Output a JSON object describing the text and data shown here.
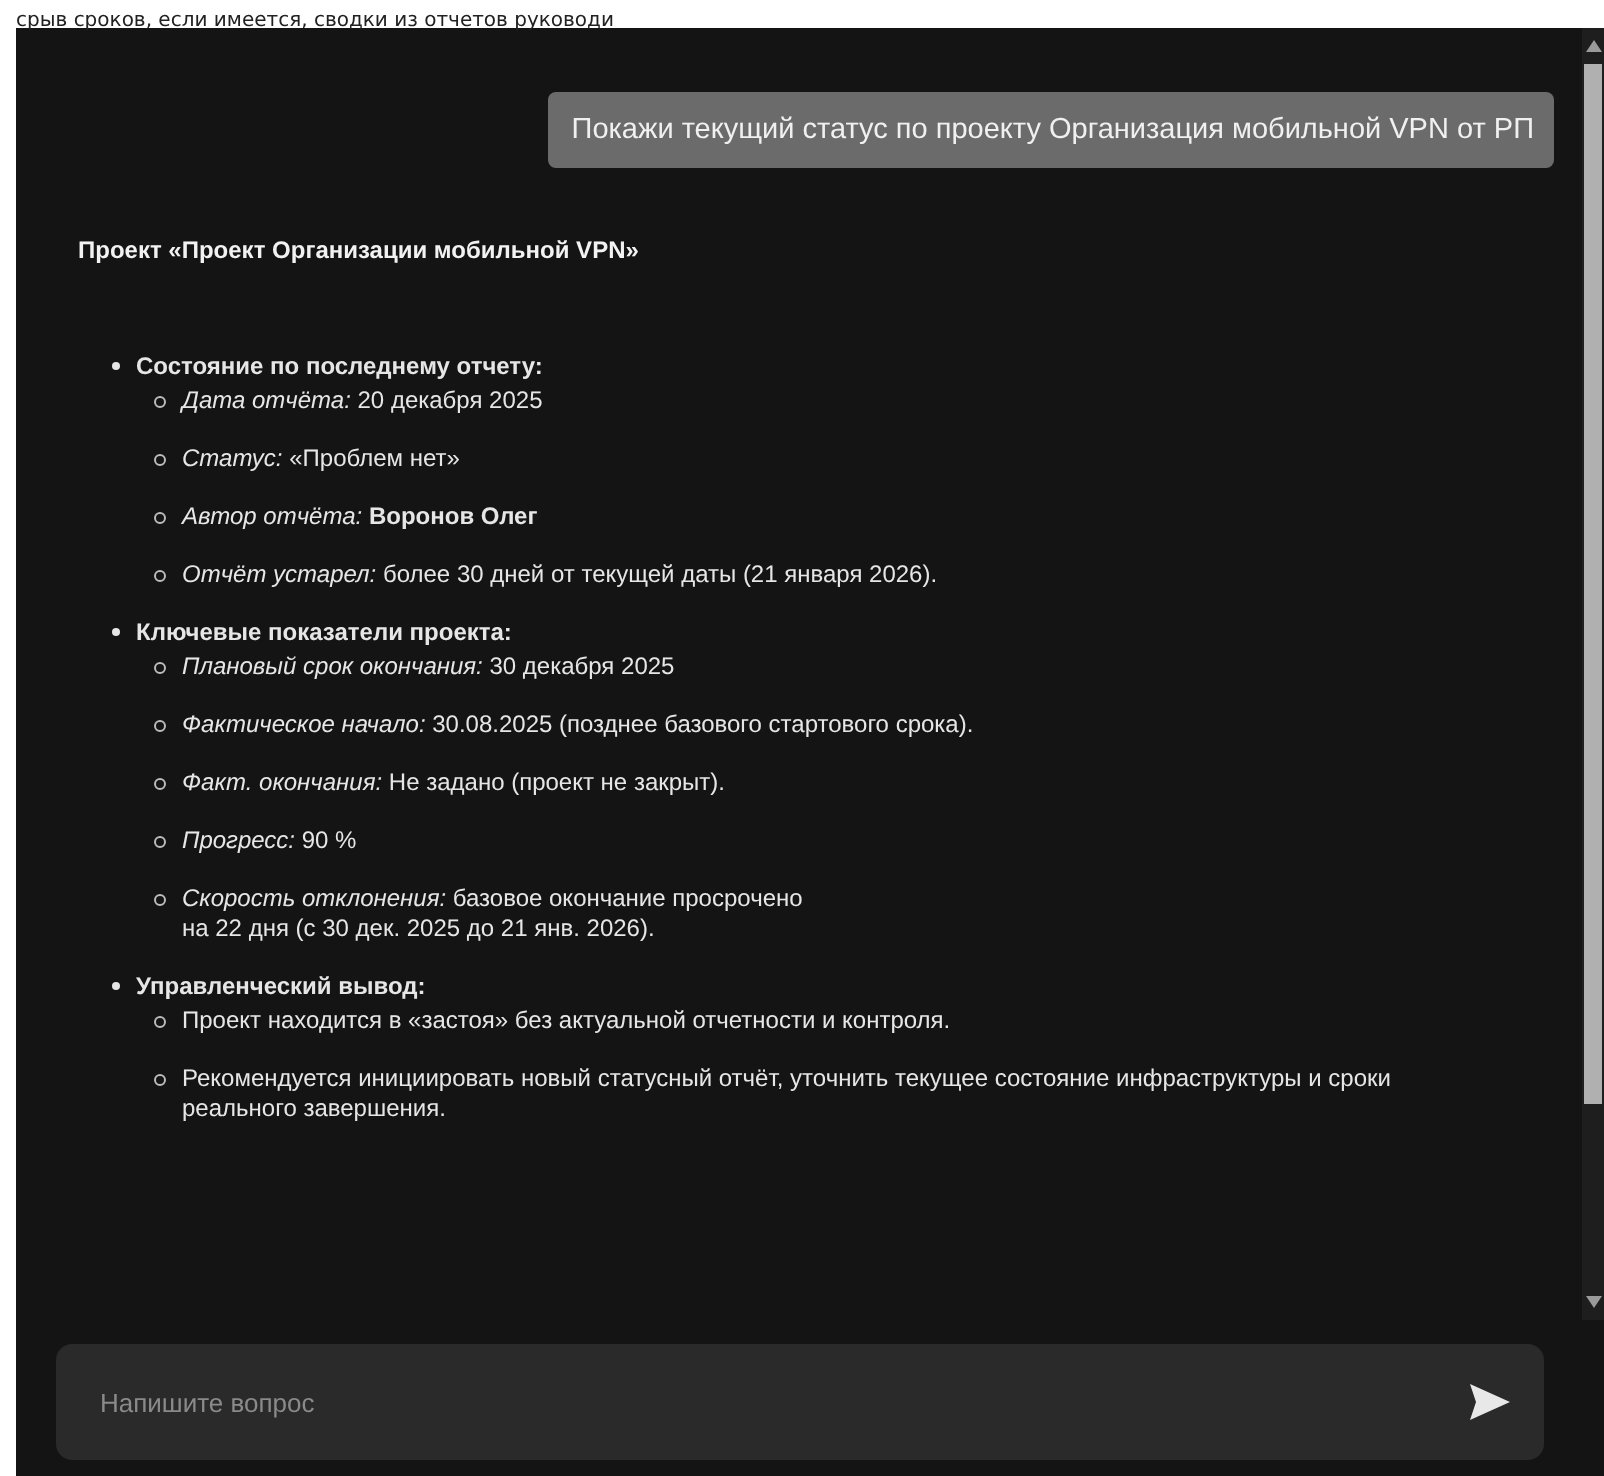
{
  "page_text": "срыв сроков, если имеется, сводки из отчетов руководи",
  "chat": {
    "user_message": "Покажи текущий статус по проекту Организация мобильной VPN от РП",
    "answer": {
      "title": "Проект «Проект Организации мобильной VPN»",
      "sections": [
        {
          "heading": "Состояние по последнему отчету:",
          "items": [
            "*Дата отчёта:* 20 декабря 2025",
            "*Статус:* «Проблем нет»",
            "*Автор отчёта:* **Воронов Олег**",
            "*Отчёт устарел:* более 30 дней от текущей даты (21 января 2026)."
          ]
        },
        {
          "heading": "Ключевые показатели проекта:",
          "items": [
            "*Плановый срок окончания:* 30 декабря 2025",
            "*Фактическое начало:* 30.08.2025 (позднее базового стартового срока).",
            "*Факт. окончания:* Не задано (проект не закрыт).",
            "*Прогресс:* 90 %",
            "*Скорость отклонения:*  базовое окончание просрочено\nна 22 дня  (с 30 дек. 2025 до 21 янв. 2026)."
          ]
        },
        {
          "heading": "Управленческий вывод:",
          "items": [
            "Проект находится в «застоя» без актуальной отчетности и контроля.",
            "Рекомендуется инициировать новый статусный отчёт, уточнить текущее состояние инфраструктуры и сроки реального завершения."
          ]
        }
      ]
    }
  },
  "input": {
    "placeholder": "Напишите вопрос"
  }
}
